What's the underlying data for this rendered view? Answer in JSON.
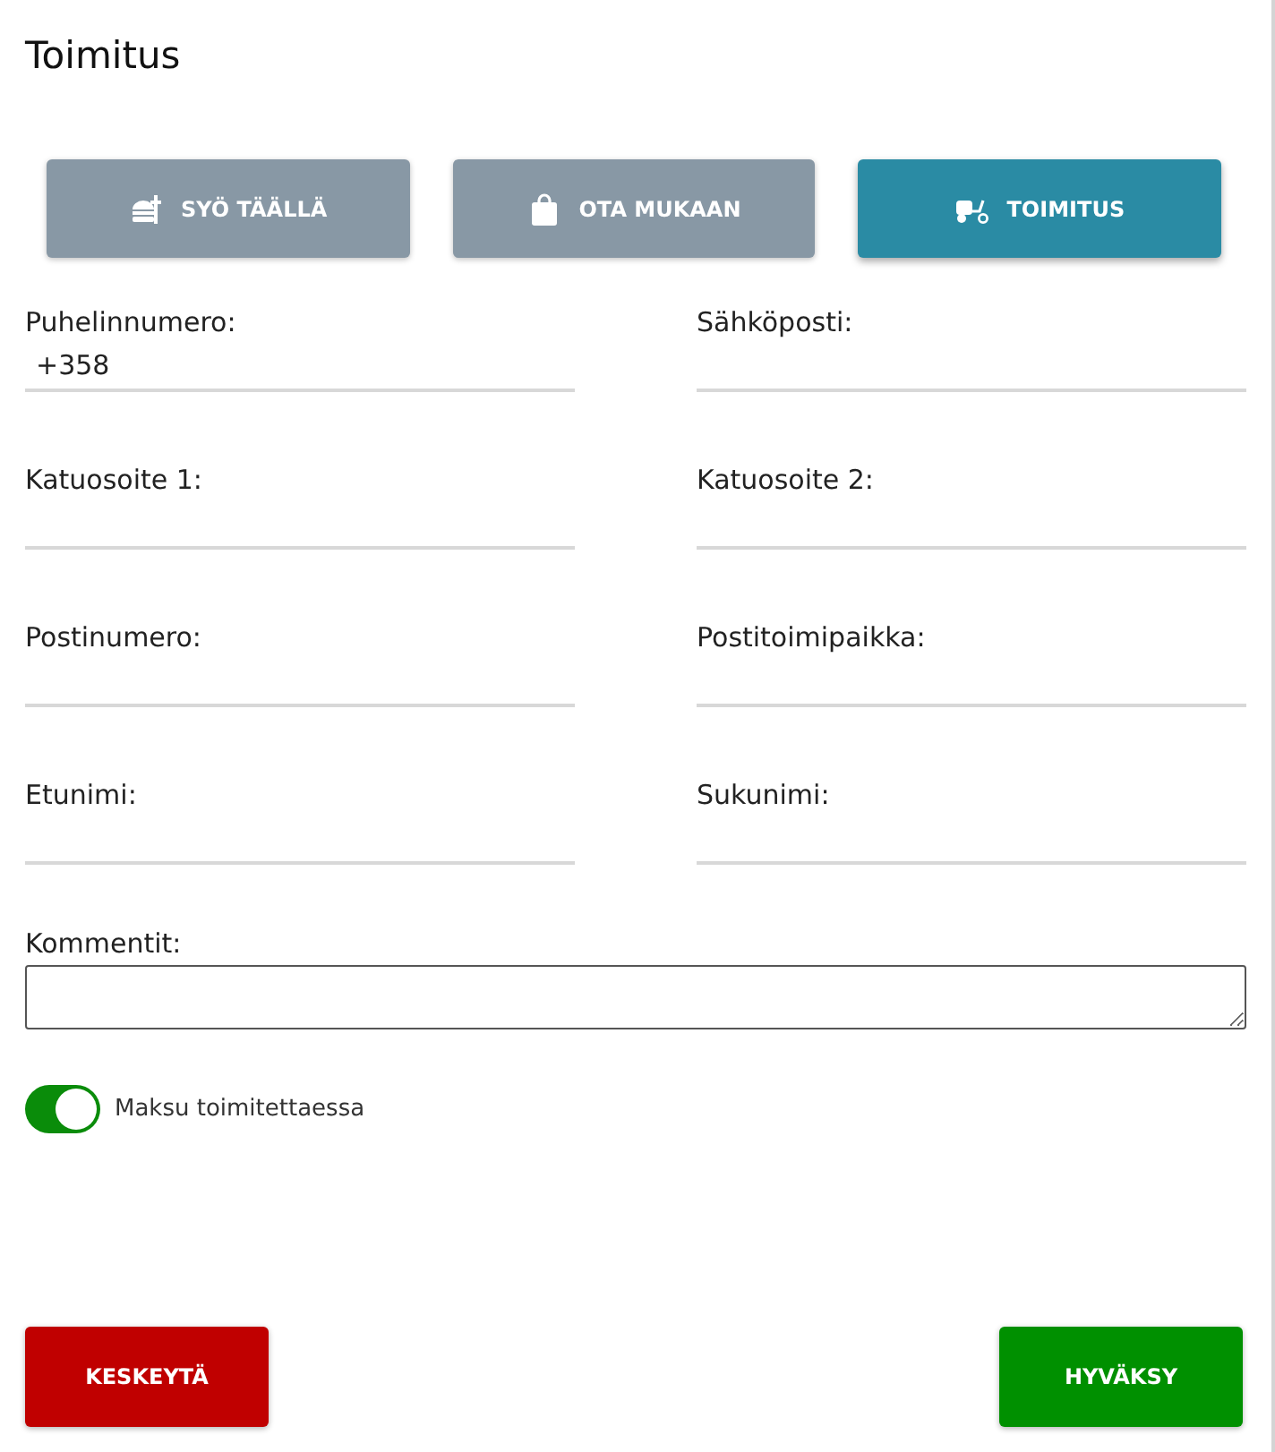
{
  "title": "Toimitus",
  "modes": [
    {
      "kind": "dine-in",
      "label": "SYÖ TÄÄLLÄ",
      "selected": false
    },
    {
      "kind": "takeaway",
      "label": "OTA MUKAAN",
      "selected": false
    },
    {
      "kind": "delivery",
      "label": "TOIMITUS",
      "selected": true
    }
  ],
  "fields": [
    {
      "label": "Puhelinnumero:",
      "value": "+358"
    },
    {
      "label": "Sähköposti:"
    },
    {
      "label": "Katuosoite 1:"
    },
    {
      "label": "Katuosoite 2:"
    },
    {
      "label": "Postinumero:"
    },
    {
      "label": "Postitoimipaikka:"
    },
    {
      "label": "Etunimi:"
    },
    {
      "label": "Sukunimi:"
    }
  ],
  "comment": {
    "label": "Kommentit:"
  },
  "payment_toggle": {
    "label": "Maksu toimitettaessa",
    "on": true
  },
  "buttons": [
    {
      "kind": "cancel",
      "label": "KESKEYTÄ"
    },
    {
      "kind": "accept",
      "label": "HYVÄKSY"
    }
  ]
}
